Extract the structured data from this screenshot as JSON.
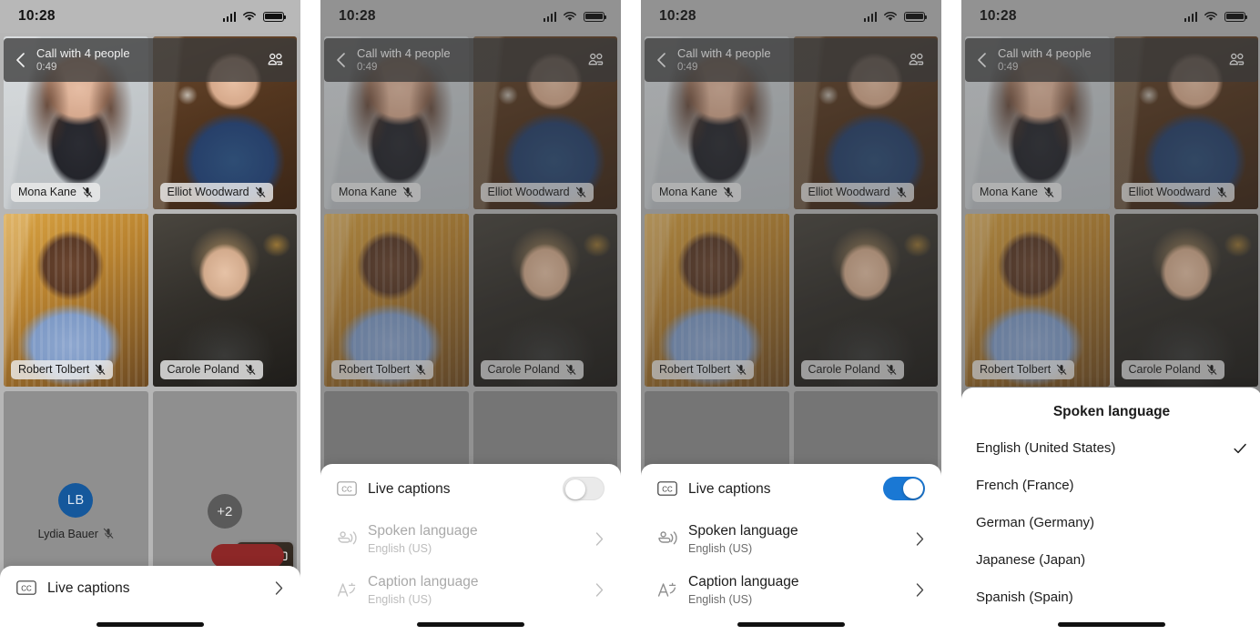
{
  "status_bar": {
    "time": "10:28",
    "signal_icon": "signal-bars-icon",
    "wifi_icon": "wifi-icon",
    "battery_icon": "battery-icon"
  },
  "call_header": {
    "back_icon": "back-chevron-icon",
    "title": "Call with 4 people",
    "timer": "0:49",
    "participants_icon": "people-icon"
  },
  "participants": [
    {
      "name": "Mona Kane",
      "muted": true
    },
    {
      "name": "Elliot Woodward",
      "muted": true
    },
    {
      "name": "Robert Tolbert",
      "muted": true
    },
    {
      "name": "Carole Poland",
      "muted": true
    },
    {
      "name": "Lydia Bauer",
      "initials": "LB",
      "muted": true
    },
    {
      "overflow_badge": "+2"
    }
  ],
  "self_view": {
    "flip_camera_icon": "flip-camera-icon"
  },
  "sheets": {
    "collapsed": {
      "live_captions_icon": "cc-icon",
      "live_captions_label": "Live captions",
      "chevron_icon": "chevron-right-icon"
    },
    "captions_off": {
      "live_captions_icon": "cc-icon",
      "live_captions_label": "Live captions",
      "toggle_state": "off",
      "spoken_language_icon": "speaking-mouth-icon",
      "spoken_language_label": "Spoken language",
      "spoken_language_value": "English (US)",
      "caption_language_icon": "translate-a-icon",
      "caption_language_label": "Caption language",
      "caption_language_value": "English (US)",
      "chevron_icon": "chevron-right-icon"
    },
    "captions_on": {
      "live_captions_icon": "cc-icon",
      "live_captions_label": "Live captions",
      "toggle_state": "on",
      "spoken_language_icon": "speaking-mouth-icon",
      "spoken_language_label": "Spoken language",
      "spoken_language_value": "English (US)",
      "caption_language_icon": "translate-a-icon",
      "caption_language_label": "Caption language",
      "caption_language_value": "English (US)",
      "chevron_icon": "chevron-right-icon"
    },
    "language_picker": {
      "title": "Spoken language",
      "options": [
        {
          "label": "English (United States)",
          "selected": true
        },
        {
          "label": "French (France)",
          "selected": false
        },
        {
          "label": "German (Germany)",
          "selected": false
        },
        {
          "label": "Japanese (Japan)",
          "selected": false
        },
        {
          "label": "Spanish (Spain)",
          "selected": false
        }
      ],
      "check_icon": "checkmark-icon"
    }
  },
  "colors": {
    "toggle_on": "#1a78d4",
    "toggle_off": "#eaeaea",
    "avatar": "#15589c",
    "end_call": "#8d2727",
    "sheet_bg": "#ffffff",
    "phone_bg": "#b6b6b6"
  }
}
